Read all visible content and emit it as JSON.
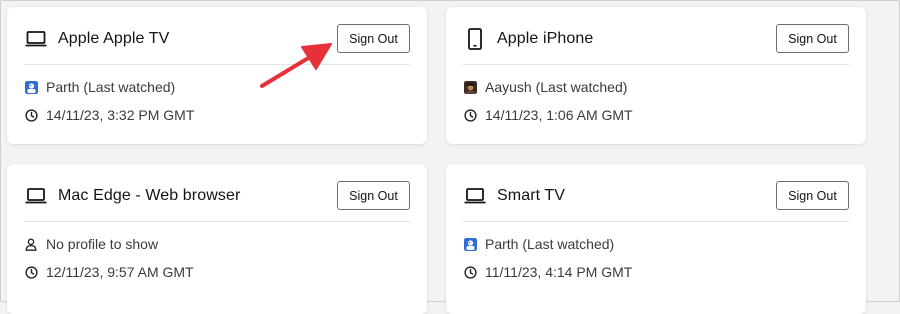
{
  "sign_out_label": "Sign Out",
  "devices": [
    {
      "title": "Apple Apple TV",
      "icon": "tv-icon",
      "profile": "Parth (Last watched)",
      "profile_icon": "avatar-blue",
      "time": "14/11/23, 3:32 PM GMT"
    },
    {
      "title": "Apple iPhone",
      "icon": "phone-icon",
      "profile": "Aayush (Last watched)",
      "profile_icon": "avatar-photo",
      "time": "14/11/23, 1:06 AM GMT"
    },
    {
      "title": "Mac Edge - Web browser",
      "icon": "laptop-icon",
      "profile": "No profile to show",
      "profile_icon": "person-icon",
      "time": "12/11/23, 9:57 AM GMT"
    },
    {
      "title": "Smart TV",
      "icon": "laptop-icon",
      "profile": "Parth (Last watched)",
      "profile_icon": "avatar-blue",
      "time": "11/11/23, 4:14 PM GMT"
    }
  ],
  "colors": {
    "annotation_arrow": "#e8303a",
    "avatar_blue": "#2f6fcf",
    "background": "#f3f3f3"
  }
}
